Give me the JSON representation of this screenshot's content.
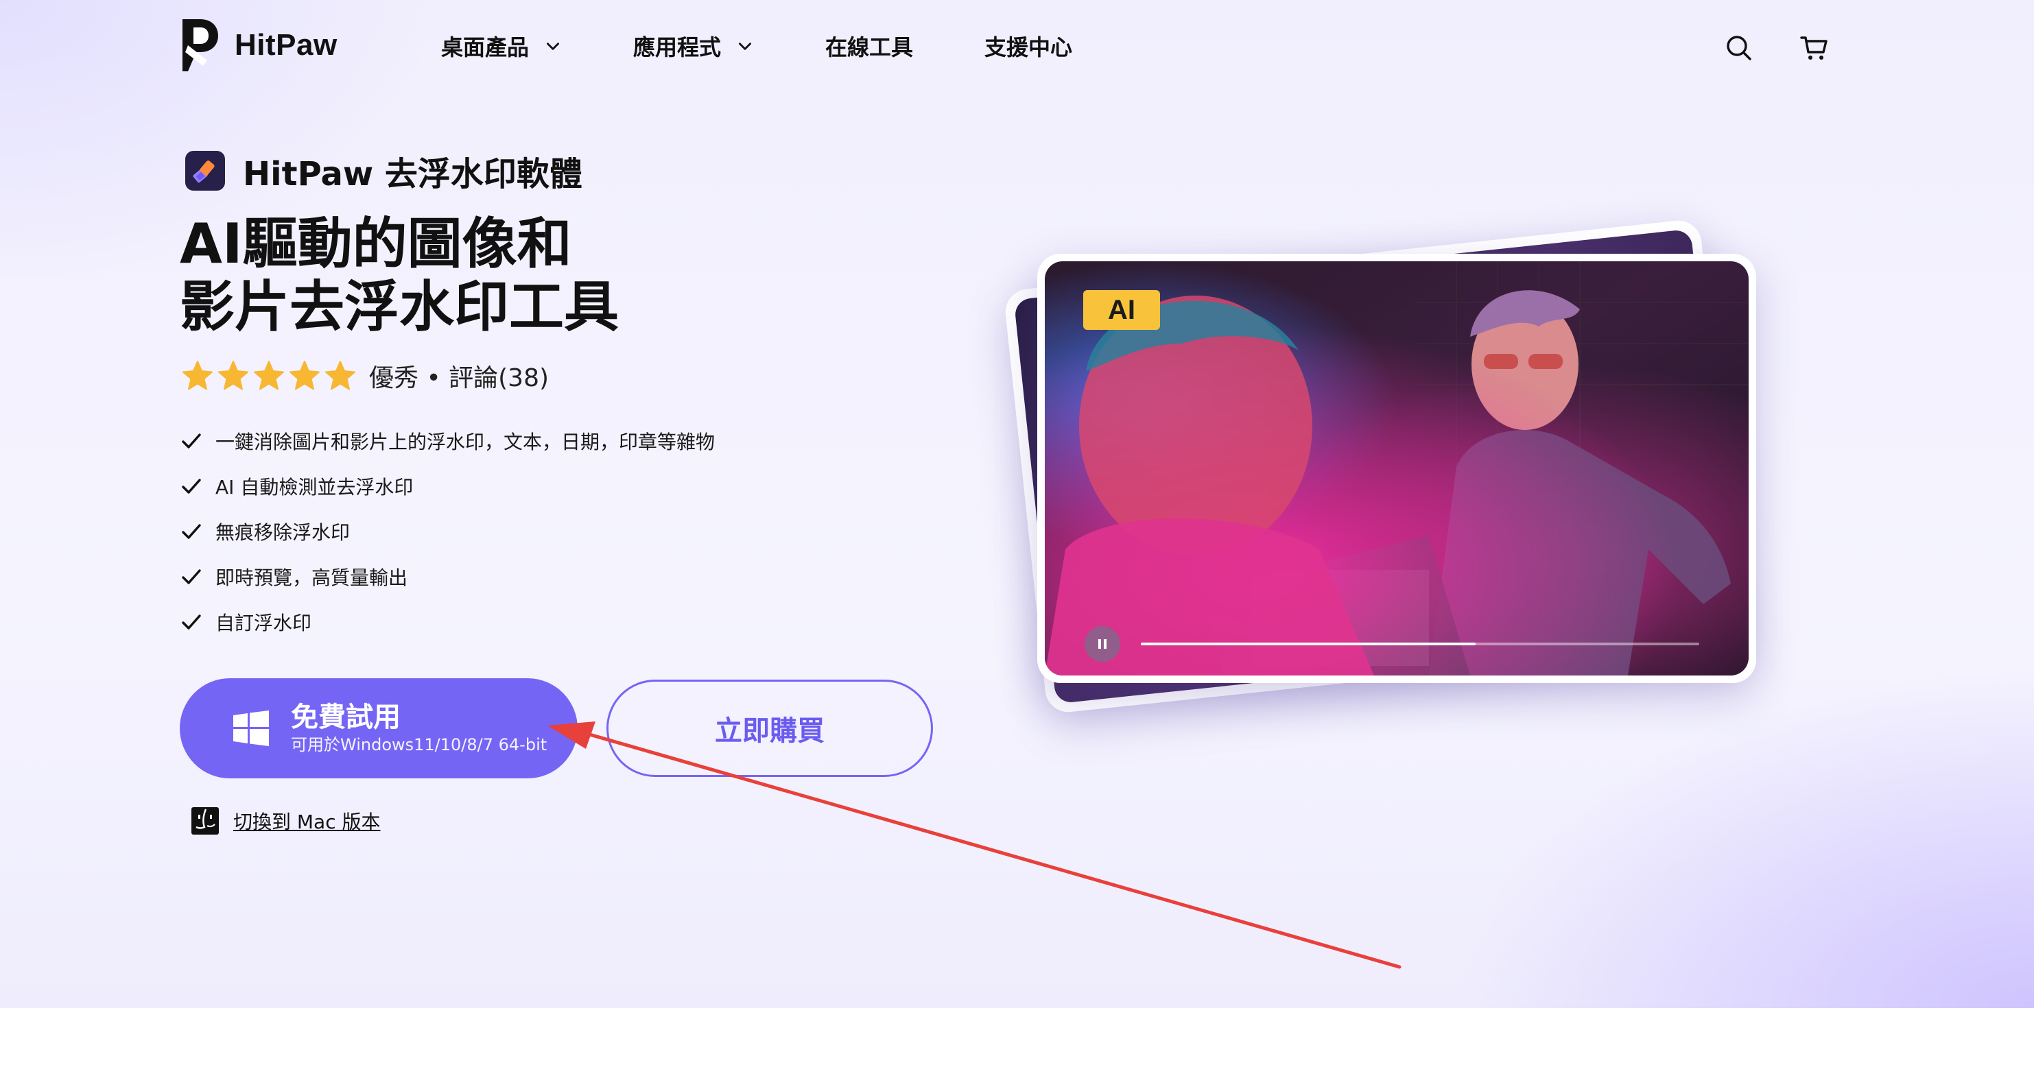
{
  "header": {
    "brand": "HitPaw",
    "nav": [
      {
        "label": "桌面產品",
        "has_dropdown": true
      },
      {
        "label": "應用程式",
        "has_dropdown": true
      },
      {
        "label": "在線工具",
        "has_dropdown": false
      },
      {
        "label": "支援中心",
        "has_dropdown": false
      }
    ],
    "icons": [
      "search-icon",
      "cart-icon"
    ]
  },
  "hero": {
    "product_name": "HitPaw 去浮水印軟體",
    "headline_line1": "AI驅動的圖像和",
    "headline_line2": "影片去浮水印工具",
    "rating": {
      "stars": 5,
      "text": "優秀 • 評論(38)"
    },
    "features": [
      "一鍵消除圖片和影片上的浮水印，文本，日期，印章等雜物",
      "AI 自動檢測並去浮水印",
      "無痕移除浮水印",
      "即時預覽，高質量輸出",
      "自訂浮水印"
    ],
    "trial_button": {
      "label": "免費試用",
      "sublabel": "可用於Windows11/10/8/7 64-bit"
    },
    "buy_button": {
      "label": "立即購買"
    },
    "mac_link": {
      "label": "切換到 Mac 版本"
    }
  },
  "preview": {
    "badge": "AI",
    "video_progress": 0.6
  },
  "colors": {
    "accent": "#7565f5",
    "badge": "#f8c33a",
    "annotation_arrow": "#e8403a"
  }
}
